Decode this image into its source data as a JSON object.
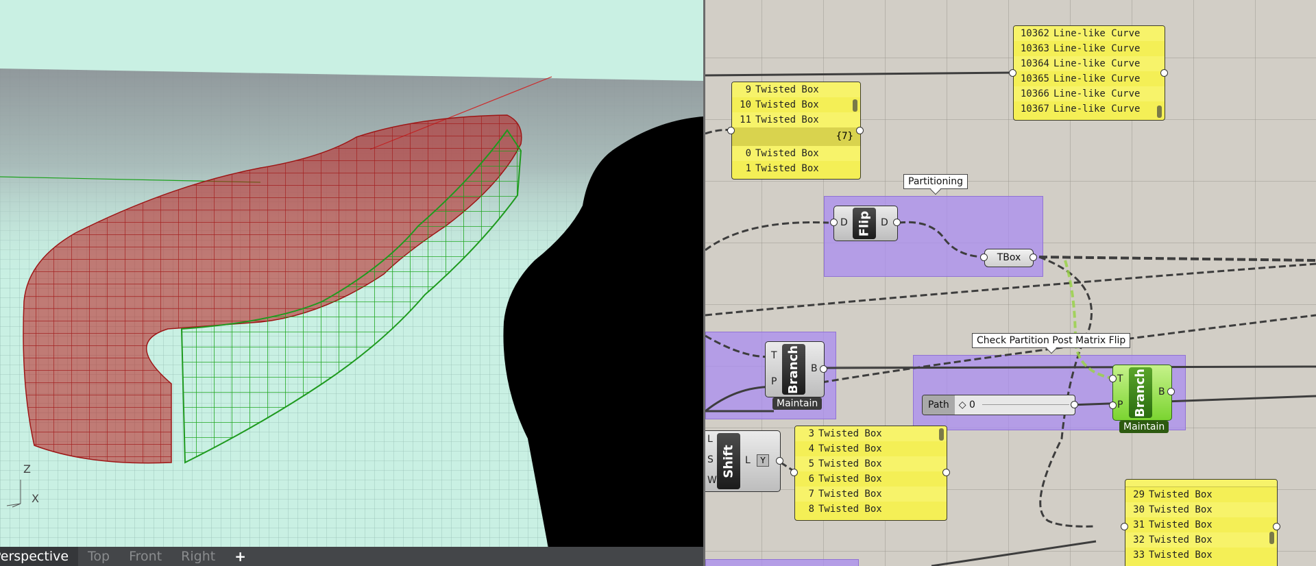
{
  "viewport": {
    "tabs": [
      "Perspective",
      "Top",
      "Front",
      "Right"
    ],
    "active_tab": "Perspective",
    "add_tab_label": "+",
    "axis_labels": {
      "z": "Z",
      "x": "X"
    },
    "colors": {
      "sky": "#c9f0e3",
      "ground": "#8b8f93",
      "red_boxes": "#b11c1c",
      "green_boxes": "#1f9a1f"
    }
  },
  "canvas": {
    "panels": {
      "line_curves": {
        "rows": [
          {
            "index": "10362",
            "value": "Line-like Curve"
          },
          {
            "index": "10363",
            "value": "Line-like Curve"
          },
          {
            "index": "10364",
            "value": "Line-like Curve"
          },
          {
            "index": "10365",
            "value": "Line-like Curve"
          },
          {
            "index": "10366",
            "value": "Line-like Curve"
          },
          {
            "index": "10367",
            "value": "Line-like Curve"
          }
        ]
      },
      "twisted_top": {
        "rows": [
          {
            "index": "9",
            "value": "Twisted Box"
          },
          {
            "index": "10",
            "value": "Twisted Box"
          },
          {
            "index": "11",
            "value": "Twisted Box"
          }
        ],
        "branch_label": "{7}",
        "rows_after": [
          {
            "index": "0",
            "value": "Twisted Box"
          },
          {
            "index": "1",
            "value": "Twisted Box"
          }
        ]
      },
      "twisted_mid": {
        "rows": [
          {
            "index": "3",
            "value": "Twisted Box"
          },
          {
            "index": "4",
            "value": "Twisted Box"
          },
          {
            "index": "5",
            "value": "Twisted Box"
          },
          {
            "index": "6",
            "value": "Twisted Box"
          },
          {
            "index": "7",
            "value": "Twisted Box"
          },
          {
            "index": "8",
            "value": "Twisted Box"
          }
        ]
      },
      "twisted_bottom": {
        "rows": [
          {
            "index": "29",
            "value": "Twisted Box"
          },
          {
            "index": "30",
            "value": "Twisted Box"
          },
          {
            "index": "31",
            "value": "Twisted Box"
          },
          {
            "index": "32",
            "value": "Twisted Box"
          },
          {
            "index": "33",
            "value": "Twisted Box"
          }
        ]
      }
    },
    "groups": {
      "partitioning": {
        "label": "Partitioning"
      },
      "check_partition": {
        "label": "Check Partition Post Matrix Flip"
      }
    },
    "components": {
      "flip": {
        "name": "Flip",
        "in": "D",
        "out": "D"
      },
      "tbox": {
        "name": "TBox"
      },
      "branch_left": {
        "name": "Branch",
        "in_t": "T",
        "in_p": "P",
        "out": "B",
        "tag": "Maintain"
      },
      "branch_right": {
        "name": "Branch",
        "in_t": "T",
        "in_p": "P",
        "out": "B",
        "tag": "Maintain"
      },
      "shift": {
        "name": "Shift",
        "in_l": "L",
        "in_s": "S",
        "in_w": "W",
        "out": "L"
      },
      "path_slider": {
        "name": "Path",
        "value": "◇ 0"
      }
    }
  }
}
